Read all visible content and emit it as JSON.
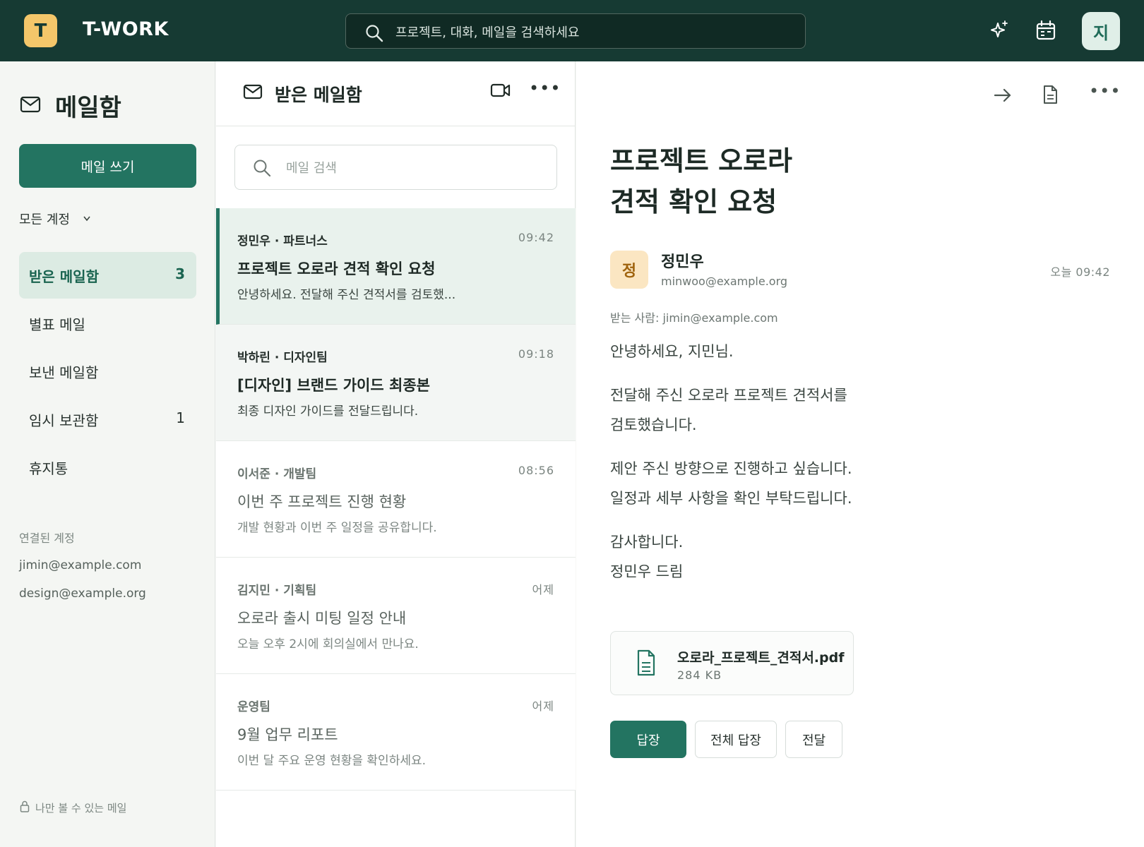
{
  "app": {
    "logo_letter": "T",
    "title": "T-WORK",
    "user_initial": "지"
  },
  "global_search": {
    "placeholder": "프로젝트, 대화, 메일을 검색하세요"
  },
  "sidebar": {
    "title": "메일함",
    "compose_label": "메일 쓰기",
    "account_select": "모든 계정",
    "items": [
      {
        "label": "받은 메일함",
        "count": "3"
      },
      {
        "label": "별표 메일",
        "count": ""
      },
      {
        "label": "보낸 메일함",
        "count": ""
      },
      {
        "label": "임시 보관함",
        "count": "1"
      },
      {
        "label": "휴지통",
        "count": ""
      }
    ],
    "linked_label": "연결된 계정",
    "linked_accounts": [
      "jimin@example.com",
      "design@example.org"
    ],
    "private_note": "나만 볼 수 있는 메일"
  },
  "maillist": {
    "title": "받은 메일함",
    "search_placeholder": "메일 검색",
    "mails": [
      {
        "sender": "정민우 · 파트너스",
        "time": "09:42",
        "subject": "프로젝트 오로라 견적 확인 요청",
        "preview": "안녕하세요. 전달해 주신 견적서를 검토했..."
      },
      {
        "sender": "박하린 · 디자인팀",
        "time": "09:18",
        "subject": "[디자인] 브랜드 가이드 최종본",
        "preview": "최종 디자인 가이드를 전달드립니다."
      },
      {
        "sender": "이서준 · 개발팀",
        "time": "08:56",
        "subject": "이번 주 프로젝트 진행 현황",
        "preview": "개발 현황과 이번 주 일정을 공유합니다."
      },
      {
        "sender": "김지민 · 기획팀",
        "time": "어제",
        "subject": "오로라 출시 미팅 일정 안내",
        "preview": "오늘 오후 2시에 회의실에서 만나요."
      },
      {
        "sender": "운영팀",
        "time": "어제",
        "subject": "9월 업무 리포트",
        "preview": "이번 달 주요 운영 현황을 확인하세요."
      }
    ]
  },
  "reader": {
    "subject_line1": "프로젝트 오로라",
    "subject_line2": "견적 확인 요청",
    "avatar_initial": "정",
    "from_name": "정민우",
    "from_email": "minwoo@example.org",
    "time": "오늘 09:42",
    "to": "받는 사람: jimin@example.com",
    "body": [
      "안녕하세요, 지민님.",
      "전달해 주신 오로라 프로젝트 견적서를",
      "검토했습니다.",
      "제안 주신 방향으로 진행하고 싶습니다.",
      "일정과 세부 사항을 확인 부탁드립니다.",
      "감사합니다.",
      "정민우 드림"
    ],
    "attachment": {
      "name": "오로라_프로젝트_견적서.pdf",
      "size": "284 KB"
    },
    "actions": {
      "reply": "답장",
      "reply_all": "전체 답장",
      "forward": "전달"
    }
  },
  "colors": {
    "topbar": "#163a33",
    "accent": "#237461",
    "logo": "#f4c66a"
  }
}
